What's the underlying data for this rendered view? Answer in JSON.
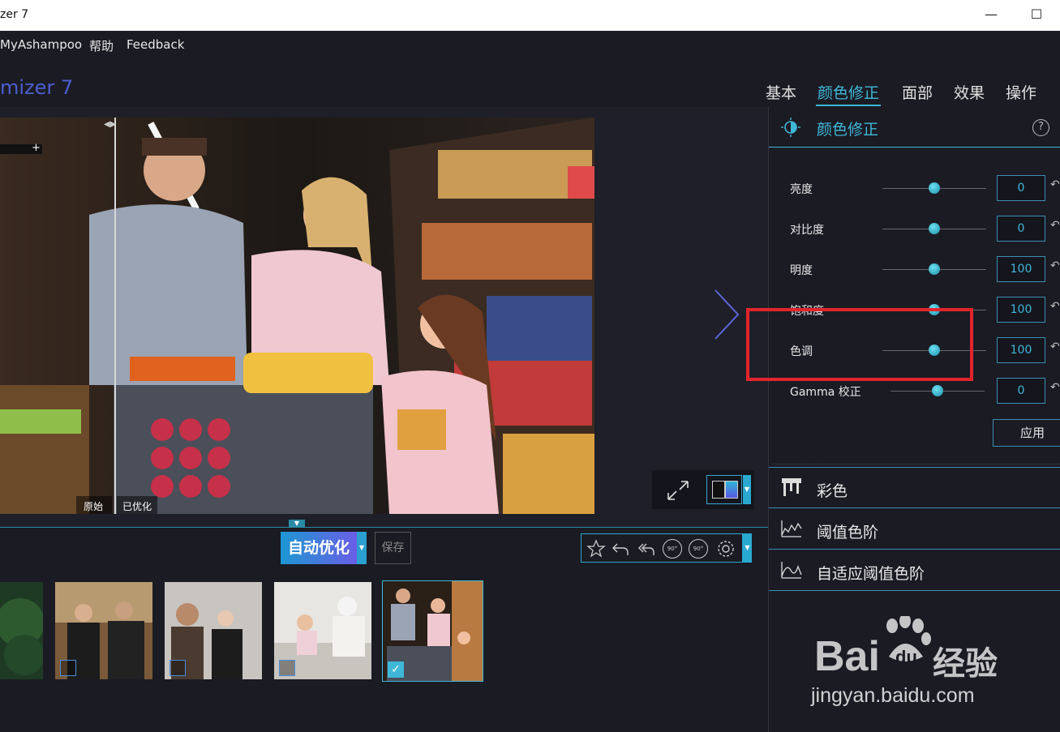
{
  "window": {
    "title": "zer 7",
    "maximize_glyph": "☐",
    "minimize_glyph": "—"
  },
  "menu": {
    "items": [
      "MyAshampoo",
      "帮助",
      "Feedback"
    ]
  },
  "header": {
    "app_title": "mizer 7",
    "tabs": [
      {
        "label": "基本",
        "active": false
      },
      {
        "label": "颜色修正",
        "active": true
      },
      {
        "label": "面部",
        "active": false
      },
      {
        "label": "效果",
        "active": false
      },
      {
        "label": "操作",
        "active": false
      }
    ]
  },
  "viewer": {
    "compare_labels": {
      "original": "原始",
      "optimized": "已优化"
    },
    "zoom_plus": "+"
  },
  "actionbar": {
    "auto_optimize_label": "自动优化",
    "save_label": "保存",
    "tools": [
      "star-icon",
      "undo-icon",
      "undo-all-icon",
      "rotate-left-90-icon",
      "rotate-right-90-icon",
      "settings-icon"
    ],
    "rotate_text": "90°"
  },
  "thumbnails": [
    {
      "name": "tree",
      "checked": false
    },
    {
      "name": "couple-gift",
      "checked": false
    },
    {
      "name": "couple-street",
      "checked": false
    },
    {
      "name": "mother-daughter-sofa",
      "checked": false
    },
    {
      "name": "family-shopping",
      "checked": true
    }
  ],
  "panel": {
    "title": "颜色修正",
    "help": "?",
    "sliders": [
      {
        "label": "亮度",
        "value": "0",
        "position": 0.5
      },
      {
        "label": "对比度",
        "value": "0",
        "position": 0.5
      },
      {
        "label": "明度",
        "value": "100",
        "position": 0.5
      },
      {
        "label": "饱和度",
        "value": "100",
        "position": 0.5
      },
      {
        "label": "色调",
        "value": "100",
        "position": 0.5
      },
      {
        "label": "Gamma 校正",
        "value": "0",
        "position": 0.5
      }
    ],
    "apply_label": "应用",
    "sections": [
      {
        "label": "彩色",
        "icon": "color-icon"
      },
      {
        "label": "阈值色阶",
        "icon": "threshold-icon"
      },
      {
        "label": "自适应阈值色阶",
        "icon": "adaptive-threshold-icon"
      }
    ]
  },
  "watermark": {
    "brand": "Bai",
    "brand2": "du",
    "cn": "经验",
    "url": "jingyan.baidu.com"
  },
  "colors": {
    "accent": "#3fb8d8",
    "highlight": "#e2252b",
    "bg": "#1b1b24"
  }
}
